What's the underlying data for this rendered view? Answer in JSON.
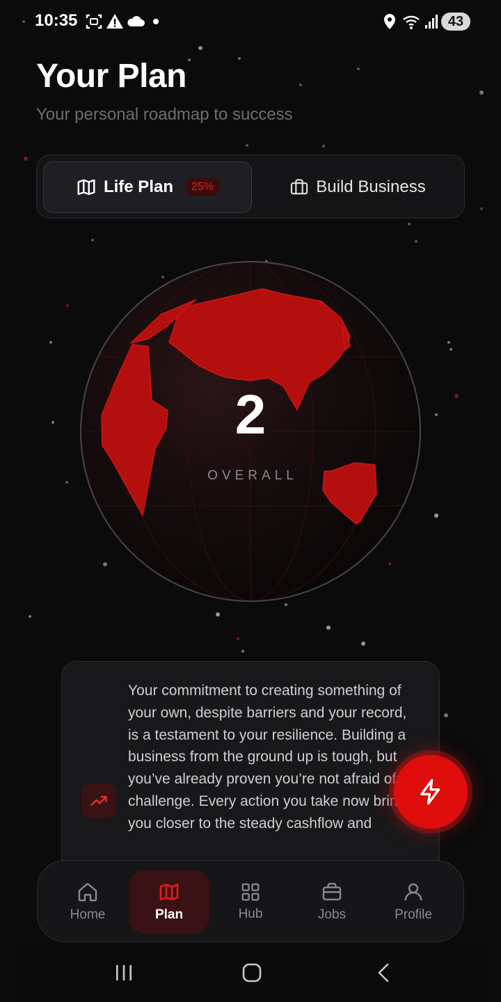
{
  "status_bar": {
    "time": "10:35",
    "battery": "43"
  },
  "header": {
    "title": "Your Plan",
    "subtitle": "Your personal roadmap to success"
  },
  "tabs": {
    "life_plan": {
      "label": "Life Plan",
      "badge": "25%",
      "progress_percent": 25
    },
    "build_business": {
      "label": "Build Business"
    }
  },
  "overall": {
    "value": "2",
    "caption": "OVERALL"
  },
  "insight": {
    "text": "Your commitment to creating something of your own, despite barriers and your record, is a testament to your resilience. Building a business from the ground up is tough, but you’ve already proven you’re not afraid of a challenge. Every action you take now brings you closer to the steady cashflow and"
  },
  "nav": {
    "items": [
      {
        "label": "Home",
        "icon": "home-icon"
      },
      {
        "label": "Plan",
        "icon": "map-icon",
        "active": true
      },
      {
        "label": "Hub",
        "icon": "grid-icon"
      },
      {
        "label": "Jobs",
        "icon": "briefcase-icon"
      },
      {
        "label": "Profile",
        "icon": "user-icon"
      }
    ]
  },
  "colors": {
    "background": "#0b0b0c",
    "accent": "#e00d0d",
    "land": "#b30f0f",
    "muted_text": "#6d6d72"
  }
}
